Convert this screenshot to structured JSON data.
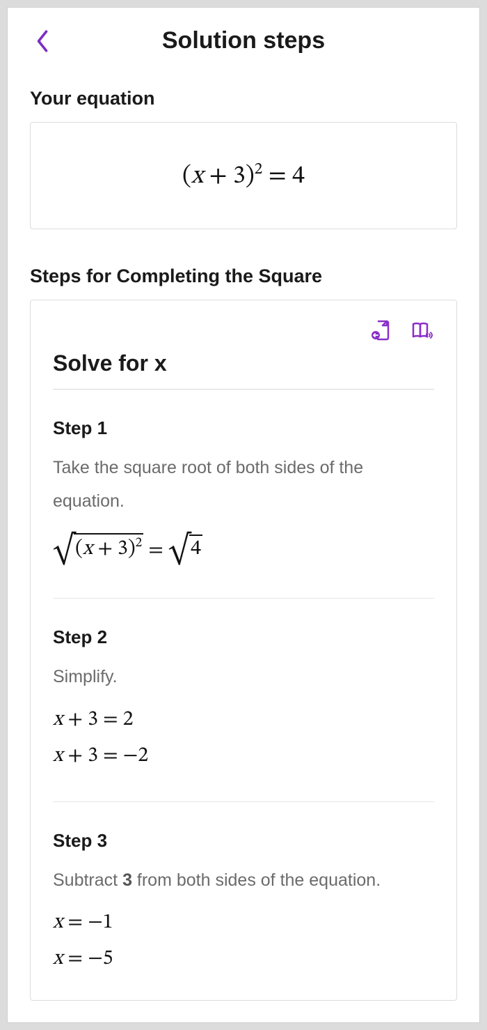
{
  "header": {
    "title": "Solution steps"
  },
  "equation": {
    "label": "Your equation",
    "display": "(x + 3)² = 4",
    "expr_html": "(<span class='it'>x</span> + 3)<span class='sup'>2</span> = 4"
  },
  "method": {
    "label": "Steps for Completing the Square"
  },
  "solve": {
    "heading": "Solve for x"
  },
  "steps": [
    {
      "title": "Step 1",
      "desc": "Take the square root of both sides of the equation.",
      "maths": [
        "<span class='sqrt'><span class='sqrt-bar'>(<span class='it'>x</span> + 3)<span class='sup'>2</span></span></span> = <span class='sqrt'><span class='sqrt-bar'>4</span></span>"
      ]
    },
    {
      "title": "Step 2",
      "desc": "Simplify.",
      "maths": [
        "<span class='it'>x</span> + 3 = 2",
        "<span class='it'>x</span> + 3 = −2"
      ]
    },
    {
      "title": "Step 3",
      "desc": "Subtract <span class='bold'>3</span> from both sides of the equation.",
      "maths": [
        "<span class='it'>x</span> = −1",
        "<span class='it'>x</span> = −5"
      ]
    }
  ]
}
